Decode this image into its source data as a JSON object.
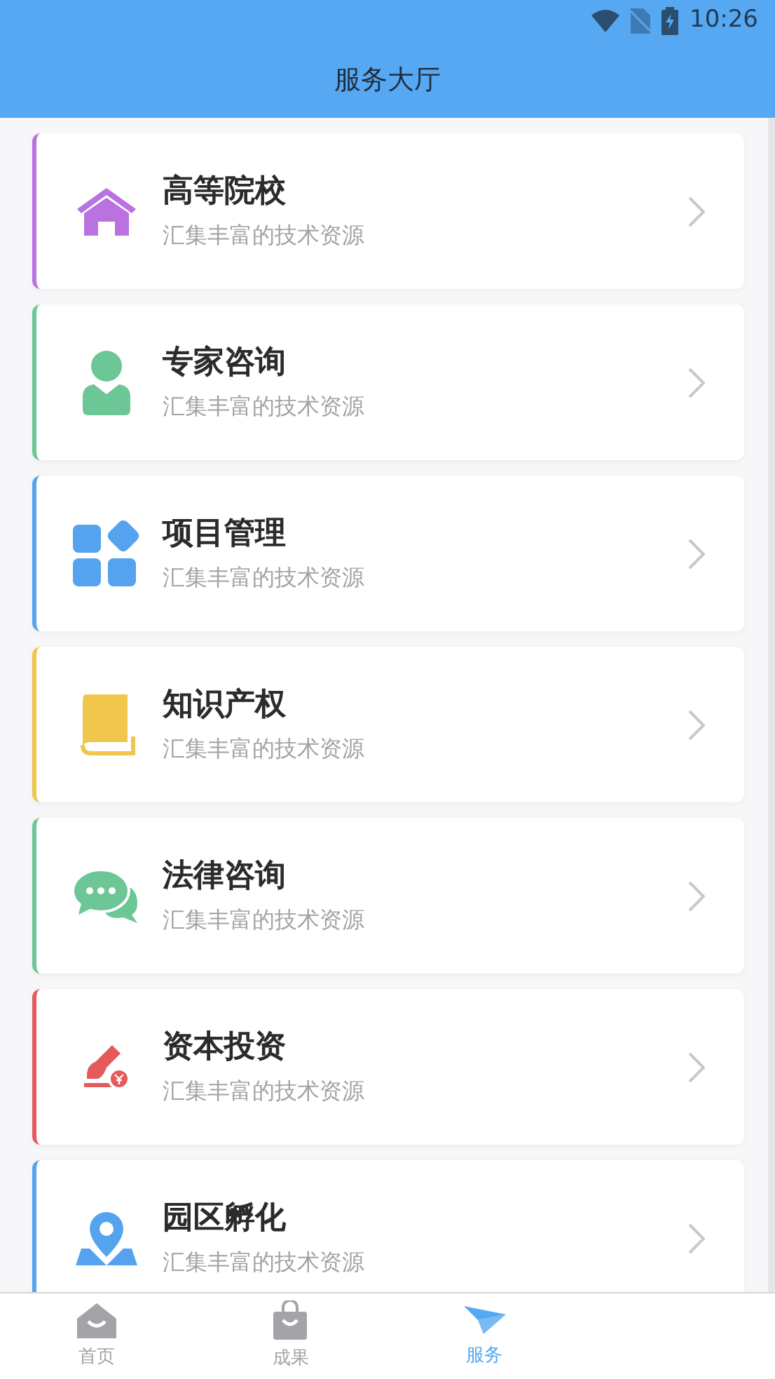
{
  "status_bar": {
    "time": "10:26"
  },
  "header": {
    "title": "服务大厅"
  },
  "services": [
    {
      "kind": "house",
      "title": "高等院校",
      "subtitle": "汇集丰富的技术资源",
      "color": "#b972e0"
    },
    {
      "kind": "person",
      "title": "专家咨询",
      "subtitle": "汇集丰富的技术资源",
      "color": "#6cc695"
    },
    {
      "kind": "blocks",
      "title": "项目管理",
      "subtitle": "汇集丰富的技术资源",
      "color": "#55a3ee"
    },
    {
      "kind": "book",
      "title": "知识产权",
      "subtitle": "汇集丰富的技术资源",
      "color": "#f0c64c"
    },
    {
      "kind": "chat",
      "title": "法律咨询",
      "subtitle": "汇集丰富的技术资源",
      "color": "#6cc695"
    },
    {
      "kind": "invest",
      "title": "资本投资",
      "subtitle": "汇集丰富的技术资源",
      "color": "#e55a5a"
    },
    {
      "kind": "pin",
      "title": "园区孵化",
      "subtitle": "汇集丰富的技术资源",
      "color": "#55a3ee"
    }
  ],
  "tabs": [
    {
      "kind": "home",
      "label": "首页",
      "selected": false
    },
    {
      "kind": "bag",
      "label": "成果",
      "selected": false
    },
    {
      "kind": "plane",
      "label": "服务",
      "selected": true
    }
  ]
}
